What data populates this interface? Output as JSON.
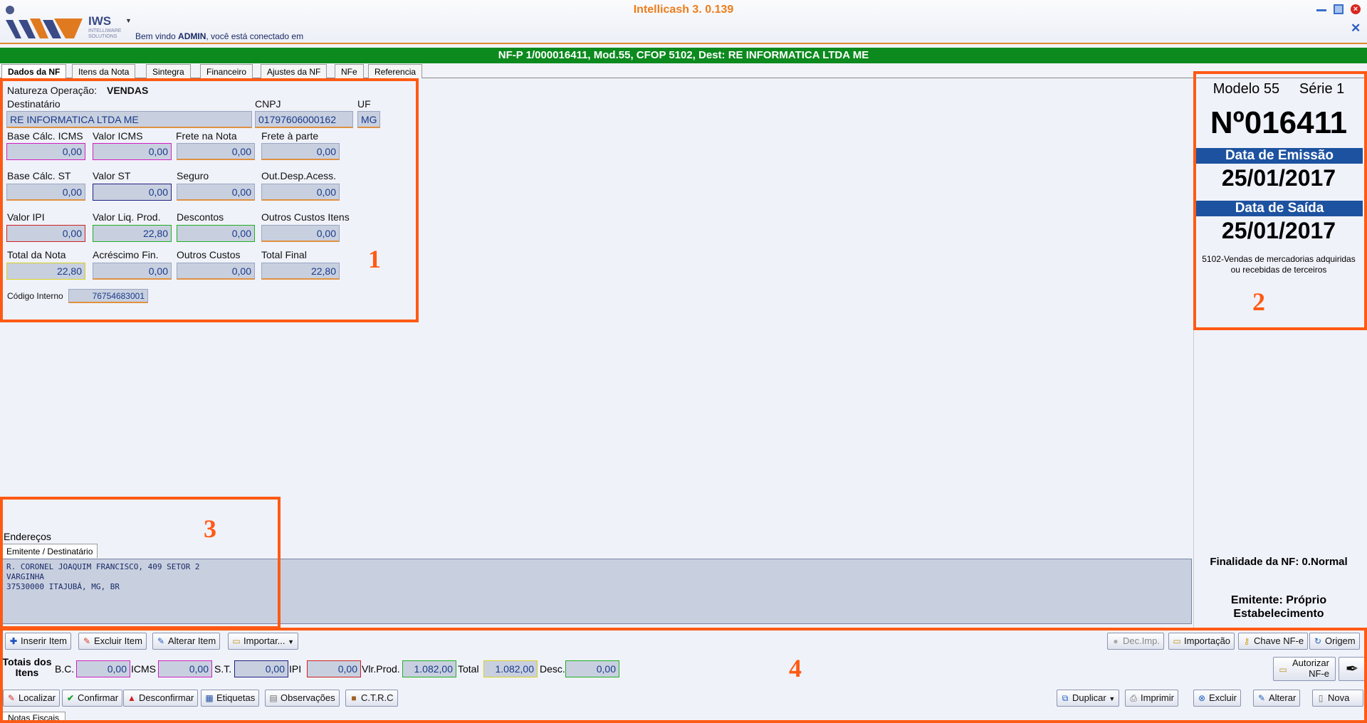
{
  "app": {
    "title": "Intellicash 3. 0.139",
    "logo_text": "IWS",
    "logo_sub": "INTELLIWARE SOLUTIONS",
    "welcome_prefix": "Bem vindo ",
    "welcome_user": "ADMIN",
    "welcome_suffix": ", você está conectado em"
  },
  "nf_header": "NF-P 1/000016411, Mod.55, CFOP 5102, Dest: RE INFORMATICA LTDA ME",
  "tabs": [
    "Dados da NF",
    "Itens da Nota",
    "Sintegra",
    "Financeiro",
    "Ajustes da NF",
    "NFe",
    "Referencia"
  ],
  "form": {
    "natureza_label": "Natureza Operação:",
    "natureza_value": "VENDAS",
    "destinatario_label": "Destinatário",
    "destinatario_value": "RE INFORMATICA LTDA ME",
    "cnpj_label": "CNPJ",
    "cnpj_value": "01797606000162",
    "uf_label": "UF",
    "uf_value": "MG",
    "fields": [
      {
        "label": "Base Cálc. ICMS",
        "value": "0,00"
      },
      {
        "label": "Valor ICMS",
        "value": "0,00"
      },
      {
        "label": "Frete na Nota",
        "value": "0,00"
      },
      {
        "label": "Frete à parte",
        "value": "0,00"
      },
      {
        "label": "Base Cálc. ST",
        "value": "0,00"
      },
      {
        "label": "Valor ST",
        "value": "0,00"
      },
      {
        "label": "Seguro",
        "value": "0,00"
      },
      {
        "label": "Out.Desp.Acess.",
        "value": "0,00"
      },
      {
        "label": "Valor IPI",
        "value": "0,00"
      },
      {
        "label": "Valor Liq. Prod.",
        "value": "22,80"
      },
      {
        "label": "Descontos",
        "value": "0,00"
      },
      {
        "label": "Outros Custos Itens",
        "value": "0,00"
      },
      {
        "label": "Total da Nota",
        "value": "22,80"
      },
      {
        "label": "Acréscimo Fin.",
        "value": "0,00"
      },
      {
        "label": "Outros Custos",
        "value": "0,00"
      },
      {
        "label": "Total Final",
        "value": "22,80"
      }
    ],
    "codigo_label": "Código Interno",
    "codigo_value": "76754683001"
  },
  "annotations": [
    "1",
    "2",
    "3",
    "4"
  ],
  "right_panel": {
    "modelo": "Modelo 55",
    "serie": "Série 1",
    "numero": "Nº016411",
    "emissao_label": "Data de Emissão",
    "emissao_value": "25/01/2017",
    "saida_label": "Data de Saída",
    "saida_value": "25/01/2017",
    "cfop_desc_1": "5102-Vendas de mercadorias adquiridas",
    "cfop_desc_2": "ou recebidas de terceiros",
    "finalidade": "Finalidade da NF: 0.Normal",
    "emitente_1": "Emitente: Próprio",
    "emitente_2": "Estabelecimento"
  },
  "address": {
    "section_label": "Endereços",
    "tab_label": "Emitente / Destinatário",
    "lines": [
      "R. CORONEL JOAQUIM FRANCISCO, 409 SETOR 2",
      "VARGINHA",
      "37530000 ITAJUBÁ, MG, BR"
    ]
  },
  "toolbar1": {
    "left": [
      "Inserir Item",
      "Excluir Item",
      "Alterar Item",
      "Importar..."
    ],
    "right": [
      "Dec.Imp.",
      "Importação",
      "Chave NF-e",
      "Origem"
    ]
  },
  "totals": {
    "title_1": "Totais dos",
    "title_2": "Itens",
    "bc_label": "B.C.",
    "bc_value": "0,00",
    "icms_label": "ICMS",
    "icms_value": "0,00",
    "st_label": "S.T.",
    "st_value": "0,00",
    "ipi_label": "IPI",
    "ipi_value": "0,00",
    "vlprod_label": "Vlr.Prod.",
    "vlprod_value": "1.082,00",
    "total_label": "Total",
    "total_value": "1.082,00",
    "desc_label": "Desc.",
    "desc_value": "0,00",
    "autorizar_1": "Autorizar",
    "autorizar_2": "NF-e"
  },
  "toolbar2": {
    "left": [
      "Localizar",
      "Confirmar",
      "Desconfirmar",
      "Etiquetas",
      "Observações",
      "C.T.R.C"
    ],
    "right": [
      "Duplicar",
      "Imprimir",
      "Excluir",
      "Alterar",
      "Nova"
    ]
  },
  "bottom_tab": "Notas Fiscais",
  "colors": {
    "accent_orange": "#ff5a14",
    "header_green": "#0c8a1e",
    "title_orange": "#ec7d1b",
    "date_bar_blue": "#1d52a0"
  }
}
